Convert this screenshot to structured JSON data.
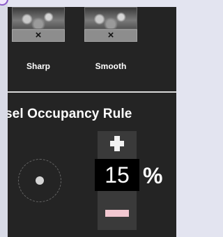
{
  "thumbnails": [
    {
      "label": "Sharp",
      "close_glyph": "×"
    },
    {
      "label": "Smooth",
      "close_glyph": "×"
    }
  ],
  "section": {
    "title": "sel Occupancy Rule"
  },
  "occupancy": {
    "value": "15",
    "unit": "%"
  },
  "icons": {
    "plus": "plus-icon",
    "minus": "minus-icon",
    "close": "close-icon",
    "pixel": "pixel-dot-icon"
  },
  "colors": {
    "panel_bg": "#242424",
    "stepper_bg": "#3a3a3a",
    "minus_accent": "#f2c8d1"
  }
}
